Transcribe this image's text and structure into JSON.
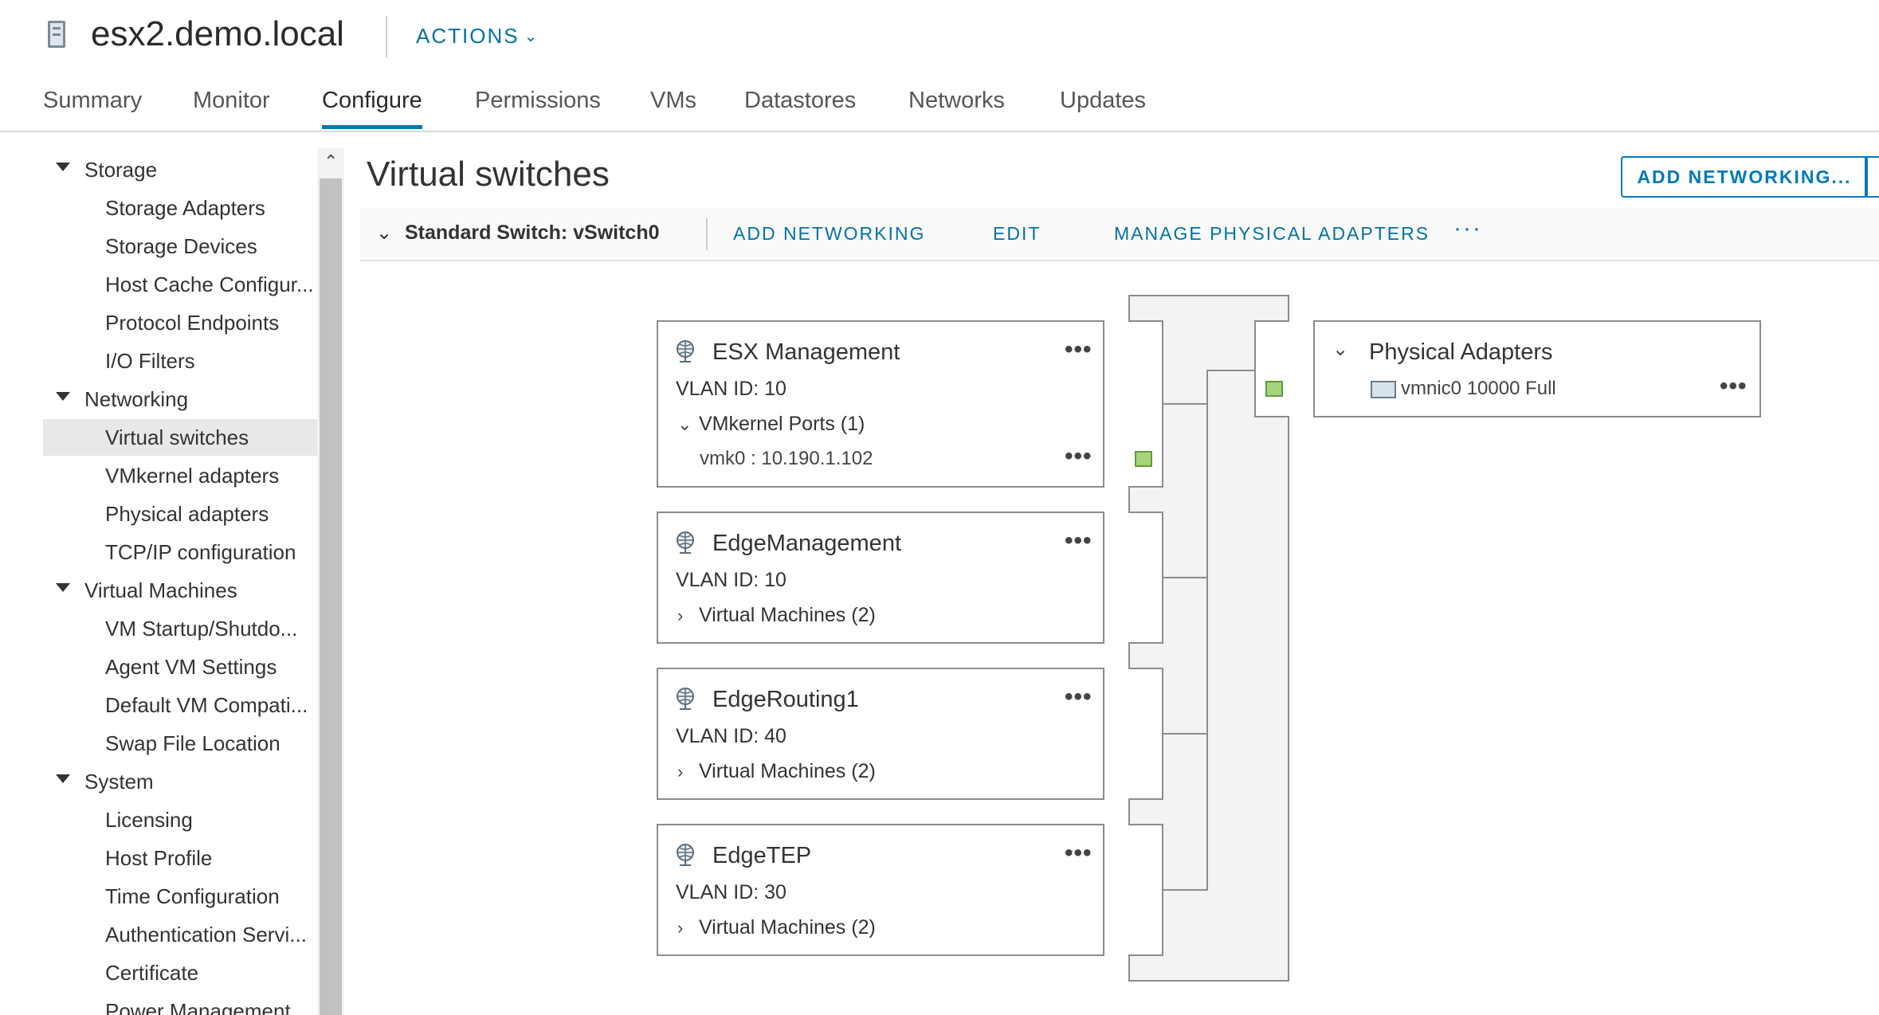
{
  "header": {
    "title": "esx2.demo.local",
    "actions_label": "ACTIONS",
    "host_icon": "host-icon"
  },
  "tabs": [
    {
      "label": "Summary"
    },
    {
      "label": "Monitor"
    },
    {
      "label": "Configure",
      "active": true
    },
    {
      "label": "Permissions"
    },
    {
      "label": "VMs"
    },
    {
      "label": "Datastores"
    },
    {
      "label": "Networks"
    },
    {
      "label": "Updates"
    }
  ],
  "nav": {
    "storage": {
      "label": "Storage",
      "items": [
        "Storage Adapters",
        "Storage Devices",
        "Host Cache Configur...",
        "Protocol Endpoints",
        "I/O Filters"
      ]
    },
    "networking": {
      "label": "Networking",
      "items": [
        "Virtual switches",
        "VMkernel adapters",
        "Physical adapters",
        "TCP/IP configuration"
      ],
      "selected": "Virtual switches"
    },
    "virtual_machines": {
      "label": "Virtual Machines",
      "items": [
        "VM Startup/Shutdo...",
        "Agent VM Settings",
        "Default VM Compati...",
        "Swap File Location"
      ]
    },
    "system": {
      "label": "System",
      "items": [
        "Licensing",
        "Host Profile",
        "Time Configuration",
        "Authentication Servi...",
        "Certificate",
        "Power Management"
      ]
    }
  },
  "main": {
    "page_title": "Virtual switches",
    "add_networking_button": "ADD NETWORKING...",
    "switch_toolbar": {
      "switch_name": "Standard Switch: vSwitch0",
      "add_networking": "ADD NETWORKING",
      "edit": "EDIT",
      "manage_adapters": "MANAGE PHYSICAL ADAPTERS",
      "more": "···"
    },
    "port_groups": [
      {
        "name": "ESX Management",
        "vlan": "VLAN ID: 10",
        "expander": "VMkernel Ports (1)",
        "expanded": true,
        "vmk": "vmk0 : 10.190.1.102"
      },
      {
        "name": "EdgeManagement",
        "vlan": "VLAN ID: 10",
        "expander": "Virtual Machines (2)",
        "expanded": false
      },
      {
        "name": "EdgeRouting1",
        "vlan": "VLAN ID: 40",
        "expander": "Virtual Machines (2)",
        "expanded": false
      },
      {
        "name": "EdgeTEP",
        "vlan": "VLAN ID: 30",
        "expander": "Virtual Machines (2)",
        "expanded": false
      }
    ],
    "physical_adapters": {
      "title": "Physical Adapters",
      "nic": "vmnic0 10000 Full"
    }
  },
  "colors": {
    "accent": "#0079b8",
    "link": "#0072a3",
    "port_active": "#a6d47a",
    "nav_selected_bg": "#e8e8e8"
  }
}
